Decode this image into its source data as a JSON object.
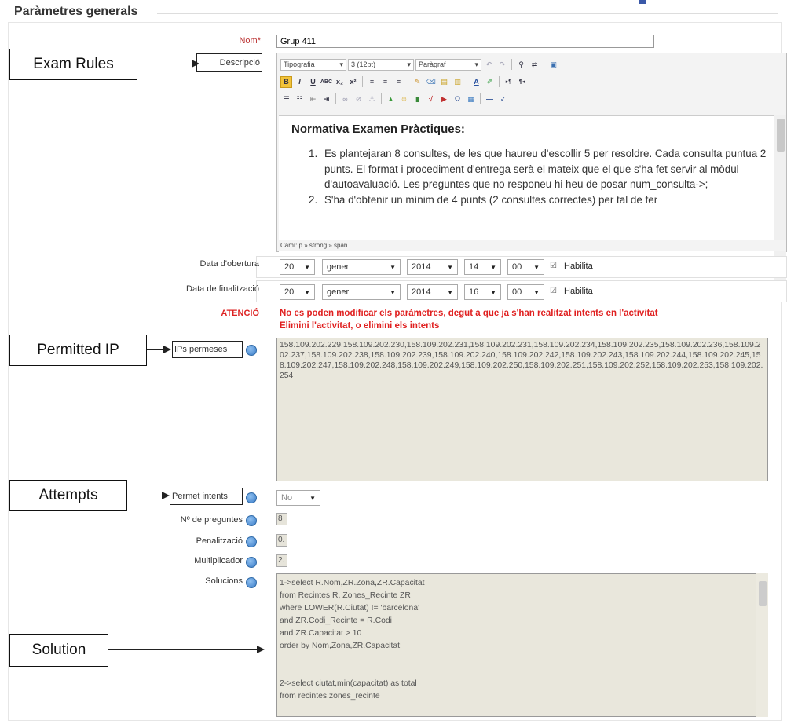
{
  "section": {
    "title": "Paràmetres generals"
  },
  "annotations": {
    "exam_rules": "Exam Rules",
    "permitted_ip": "Permitted IP",
    "attempts": "Attempts",
    "solution": "Solution"
  },
  "name_field": {
    "label": "Nom*",
    "value": "Grup 411"
  },
  "description": {
    "label": "Descripció",
    "toolbar": {
      "font_family": "Tipografia",
      "font_size": "3 (12pt)",
      "format": "Paràgraf",
      "row2_buttons": [
        "B",
        "I",
        "U",
        "ABC",
        "x₂",
        "x²"
      ],
      "icon_names": [
        "undo-icon",
        "redo-icon",
        "find-icon",
        "replace-icon",
        "fullscreen-icon",
        "align-left-icon",
        "align-center-icon",
        "align-right-icon",
        "cleanup-icon",
        "paste-icon",
        "text-color-icon",
        "highlight-icon",
        "ltr-icon",
        "rtl-icon",
        "bullets-icon",
        "numbering-icon",
        "outdent-icon",
        "indent-icon",
        "link-icon",
        "unlink-icon",
        "anchor-icon",
        "image-icon",
        "media-icon",
        "emoticon-icon",
        "special-char-icon",
        "table-icon",
        "hr-icon",
        "spellcheck-icon"
      ]
    },
    "heading": "Normativa Examen Pràctiques:",
    "items": [
      {
        "num": "1.",
        "text": "Es plantejaran 8 consultes, de les que haureu d'escollir 5 per resoldre. Cada consulta puntua 2 punts. El format i procediment d'entrega serà el mateix que el que s'ha fet servir al mòdul d'autoavaluació. Les preguntes que no responeu hi heu de posar num_consulta->;"
      },
      {
        "num": "2.",
        "text": "S'ha d'obtenir un mínim de 4 punts (2 consultes correctes) per tal de fer"
      }
    ],
    "path": "Camí: p » strong » span"
  },
  "open_date": {
    "label": "Data d'obertura",
    "day": "20",
    "month": "gener",
    "year": "2014",
    "hour": "14",
    "minute": "00",
    "enable_label": "Habilita"
  },
  "close_date": {
    "label": "Data de finalització",
    "day": "20",
    "month": "gener",
    "year": "2014",
    "hour": "16",
    "minute": "00",
    "enable_label": "Habilita"
  },
  "warning": {
    "label": "ATENCIÓ",
    "line1": "No es poden modificar els paràmetres, degut a que ja s'han realitzat intents en l'activitat",
    "line2": "Elimini l'activitat, o elimini els intents"
  },
  "ips": {
    "label": "IPs permeses",
    "value": "158.109.202.229,158.109.202.230,158.109.202.231,158.109.202.231,158.109.202.234,158.109.202.235,158.109.202.236,158.109.202.237,158.109.202.238,158.109.202.239,158.109.202.240,158.109.202.242,158.109.202.243,158.109.202.244,158.109.202.245,158.109.202.247,158.109.202.248,158.109.202.249,158.109.202.250,158.109.202.251,158.109.202.252,158.109.202.253,158.109.202.254"
  },
  "attempts": {
    "label": "Permet intents",
    "value": "No"
  },
  "num_questions": {
    "label": "Nº de preguntes",
    "value": "8"
  },
  "penalty": {
    "label": "Penalització",
    "value": "0."
  },
  "multiplier": {
    "label": "Multiplicador",
    "value": "2."
  },
  "solutions": {
    "label": "Solucions",
    "value": "1->select R.Nom,ZR.Zona,ZR.Capacitat\nfrom Recintes R, Zones_Recinte ZR\nwhere LOWER(R.Ciutat) != 'barcelona'\nand ZR.Codi_Recinte = R.Codi\nand ZR.Capacitat > 10\norder by Nom,Zona,ZR.Capacitat;\n\n\n2->select ciutat,min(capacitat) as total\nfrom recintes,zones_recinte"
  }
}
